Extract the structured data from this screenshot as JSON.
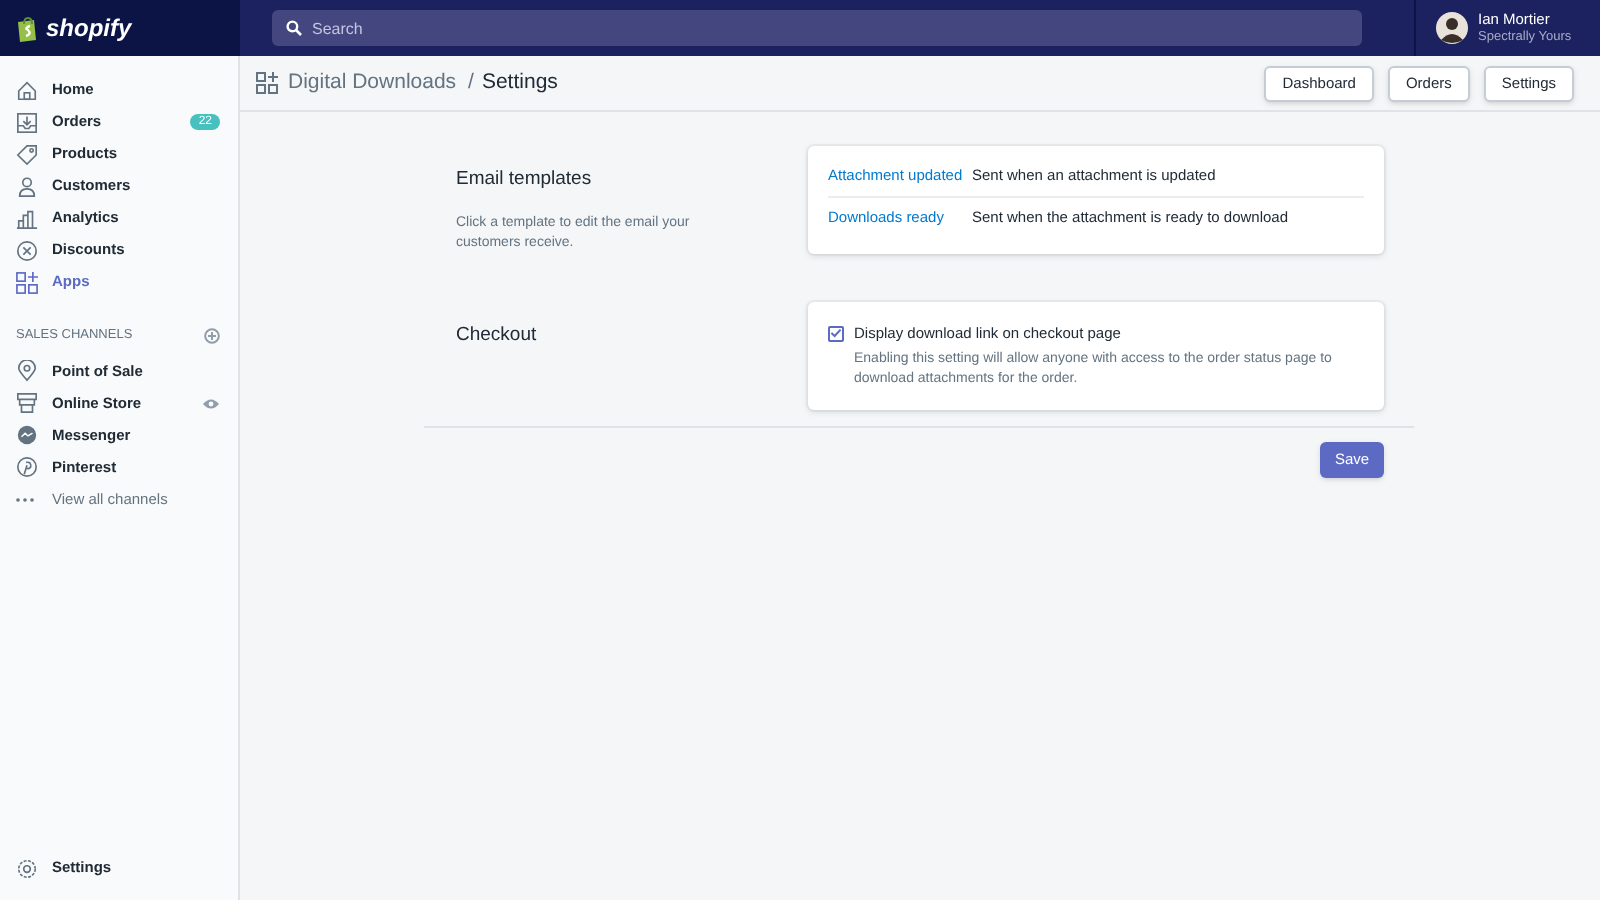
{
  "top_bar": {
    "logo": "shopify",
    "search": {
      "placeholder": "Search"
    },
    "user": {
      "name": "Ian Mortier",
      "store": "Spectrally Yours"
    }
  },
  "sidebar": {
    "items": [
      {
        "label": "Home",
        "selected": false
      },
      {
        "label": "Orders",
        "selected": false,
        "badge": "22"
      },
      {
        "label": "Products",
        "selected": false
      },
      {
        "label": "Customers",
        "selected": false
      },
      {
        "label": "Analytics",
        "selected": false
      },
      {
        "label": "Discounts",
        "selected": false
      },
      {
        "label": "Apps",
        "selected": true
      }
    ],
    "sales_channels": {
      "heading": "SALES CHANNELS",
      "items": [
        {
          "label": "Point of Sale",
          "selected": false
        },
        {
          "label": "Online Store",
          "selected": false
        },
        {
          "label": "Messenger",
          "selected": false
        },
        {
          "label": "Pinterest",
          "selected": false
        }
      ],
      "more": "View all channels"
    },
    "settings": "Settings"
  },
  "header": {
    "breadcrumb": "Digital Downloads",
    "separator": "/",
    "title": "Settings",
    "buttons": [
      "Dashboard",
      "Orders",
      "Settings"
    ]
  },
  "sections": [
    {
      "kind": "templates",
      "title": "Email templates",
      "description": "Click a template to edit the email your customers receive.",
      "rows": [
        {
          "link": "Attachment updated",
          "text": "Sent when an attachment is updated"
        },
        {
          "link": "Downloads ready",
          "text": "Sent when the attachment is ready to download"
        }
      ]
    },
    {
      "kind": "checkbox",
      "title": "Checkout",
      "label": "Display download link on checkout page",
      "checked": true,
      "help": "Enabling this setting will allow anyone with access to the order status page to download attachments for the order."
    }
  ],
  "save_button": "Save"
}
